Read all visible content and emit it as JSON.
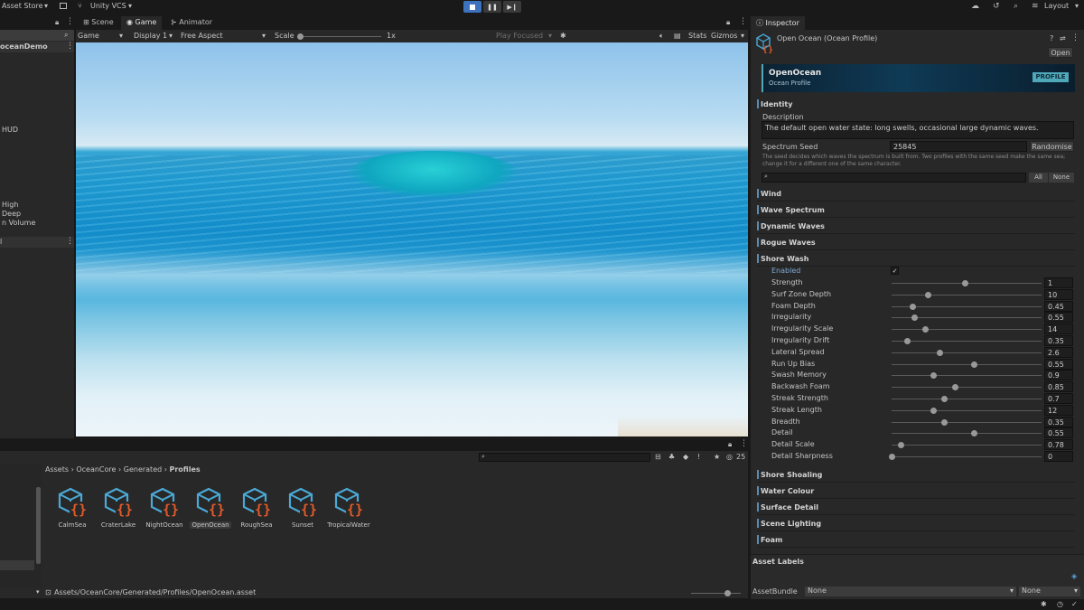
{
  "topbar": {
    "asset_store": "Asset Store",
    "vcs": "Unity VCS",
    "layout": "Layout"
  },
  "hierarchy": {
    "scene_name": "oceanDemo",
    "items": [
      "HUD",
      "High",
      "Deep",
      "n Volume"
    ],
    "row2": "l"
  },
  "tabs": {
    "scene": "Scene",
    "game": "Game",
    "animator": "Animator",
    "inspector": "Inspector"
  },
  "game_toolbar": {
    "display_mode": "Game",
    "display": "Display 1",
    "aspect": "Free Aspect",
    "scale_label": "Scale",
    "scale_value": "1x",
    "play_focused": "Play Focused",
    "stats": "Stats",
    "gizmos": "Gizmos"
  },
  "project": {
    "breadcrumb": [
      "Assets",
      "OceanCore",
      "Generated",
      "Profiles"
    ],
    "count": "25",
    "path": "Assets/OceanCore/Generated/Profiles/OpenOcean.asset",
    "assets": [
      {
        "name": "CalmSea"
      },
      {
        "name": "CraterLake"
      },
      {
        "name": "NightOcean"
      },
      {
        "name": "OpenOcean"
      },
      {
        "name": "RoughSea"
      },
      {
        "name": "Sunset"
      },
      {
        "name": "TropicalWater"
      }
    ]
  },
  "inspector": {
    "header_title": "Open Ocean (Ocean Profile)",
    "open_button": "Open",
    "banner": {
      "title": "OpenOcean",
      "subtitle": "Ocean Profile",
      "badge": "PROFILE"
    },
    "identity": {
      "title": "Identity",
      "description_label": "Description",
      "description": "The default open water state: long swells, occasional large dynamic waves.",
      "seed_label": "Spectrum Seed",
      "seed_value": "25845",
      "randomise": "Randomise",
      "seed_help_1": "The seed decides which waves the spectrum is built from. Two profiles with the same seed make the same sea;",
      "seed_help_2": "change it for a different one of the same character.",
      "all_button": "All",
      "none_button": "None"
    },
    "sections_top": [
      "Wind",
      "Wave Spectrum",
      "Dynamic Waves",
      "Rogue Waves",
      "Shore Wash"
    ],
    "shore_wash": {
      "enabled_label": "Enabled",
      "params": [
        {
          "label": "Strength",
          "value": "1",
          "t": 0.49
        },
        {
          "label": "Surf Zone Depth",
          "value": "10",
          "t": 0.24
        },
        {
          "label": "Foam Depth",
          "value": "0.45",
          "t": 0.14
        },
        {
          "label": "Irregularity",
          "value": "0.55",
          "t": 0.15
        },
        {
          "label": "Irregularity Scale",
          "value": "14",
          "t": 0.22
        },
        {
          "label": "Irregularity Drift",
          "value": "0.35",
          "t": 0.1
        },
        {
          "label": "Lateral Spread",
          "value": "2.6",
          "t": 0.32
        },
        {
          "label": "Run Up Bias",
          "value": "0.55",
          "t": 0.55
        },
        {
          "label": "Swash Memory",
          "value": "0.9",
          "t": 0.28
        },
        {
          "label": "Backwash Foam",
          "value": "0.85",
          "t": 0.42
        },
        {
          "label": "Streak Strength",
          "value": "0.7",
          "t": 0.35
        },
        {
          "label": "Streak Length",
          "value": "12",
          "t": 0.28
        },
        {
          "label": "Breadth",
          "value": "0.35",
          "t": 0.35
        },
        {
          "label": "Detail",
          "value": "0.55",
          "t": 0.55
        },
        {
          "label": "Detail Scale",
          "value": "0.78",
          "t": 0.06
        },
        {
          "label": "Detail Sharpness",
          "value": "0",
          "t": 0.0
        }
      ]
    },
    "sections_bottom": [
      "Shore Shoaling",
      "Water Colour",
      "Surface Detail",
      "Scene Lighting",
      "Foam"
    ],
    "asset_labels": "Asset Labels",
    "asset_bundle_label": "AssetBundle",
    "asset_bundle_value": "None",
    "asset_variant_value": "None"
  },
  "colors": {
    "accent": "#3d72bf",
    "badge": "#4fa8b8",
    "icon_cube": "#4aa9d6",
    "icon_braces": "#e05a2a"
  }
}
